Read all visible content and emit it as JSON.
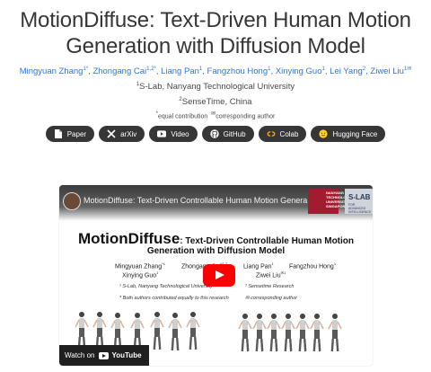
{
  "title_line1": "MotionDiffuse: Text-Driven Human Motion",
  "title_line2": "Generation with Diffusion Model",
  "authors": [
    {
      "name": "Mingyuan Zhang",
      "sup": "1*"
    },
    {
      "name": "Zhongang Cai",
      "sup": "1,2*"
    },
    {
      "name": "Liang Pan",
      "sup": "1"
    },
    {
      "name": "Fangzhou Hong",
      "sup": "1"
    },
    {
      "name": "Xinying Guo",
      "sup": "1"
    },
    {
      "name": "Lei Yang",
      "sup": "2"
    },
    {
      "name": "Ziwei Liu",
      "sup": "1✉"
    }
  ],
  "affiliation1": {
    "sup": "1",
    "text": "S-Lab, Nanyang Technological University"
  },
  "affiliation2": {
    "sup": "2",
    "text": "SenseTime, China"
  },
  "notes": {
    "equal_sup": "*",
    "equal": "equal contribution",
    "corr_sup": "✉",
    "corr": "corresponding author"
  },
  "buttons": [
    {
      "label": "Paper",
      "icon": "pdf-icon"
    },
    {
      "label": "arXiv",
      "icon": "arxiv-icon"
    },
    {
      "label": "Video",
      "icon": "youtube-icon"
    },
    {
      "label": "GitHub",
      "icon": "github-icon"
    },
    {
      "label": "Colab",
      "icon": "colab-icon"
    },
    {
      "label": "Hugging Face",
      "icon": "huggingface-icon"
    }
  ],
  "video": {
    "top_title": "MotionDiffuse: Text-Driven Controllable Human Motion Genera...",
    "ntu_logo": "NANYANG TECHNOLOGICAL UNIVERSITY SINGAPORE",
    "slab_logo": "S-LAB",
    "slab_sub": "FOR ADVANCED INTELLIGENCE",
    "heading_big": "MotionDiffuse",
    "heading_rest": ": Text-Driven Controllable Human Motion",
    "heading_line2": "Generation with Diffusion Model",
    "authors_row1": [
      {
        "name": "Mingyuan Zhang",
        "sup": "*1"
      },
      {
        "name": "Zhongang Cai",
        "sup": "*1,2"
      },
      {
        "name": "Liang Pan",
        "sup": "1"
      },
      {
        "name": "Fangzhou Hong",
        "sup": "1"
      }
    ],
    "authors_row2": [
      {
        "name": "Xinying Guo",
        "sup": "1"
      },
      {
        "name": "Ziwei Liu",
        "sup": "✉1"
      }
    ],
    "aff1": "¹ S-Lab, Nanyang Technological University",
    "aff2": "² Sensetime Research",
    "note1": "* Both authors contributed equally to this research",
    "note2": "✉ corresponding author",
    "watch_on": "Watch on",
    "youtube": "YouTube"
  }
}
